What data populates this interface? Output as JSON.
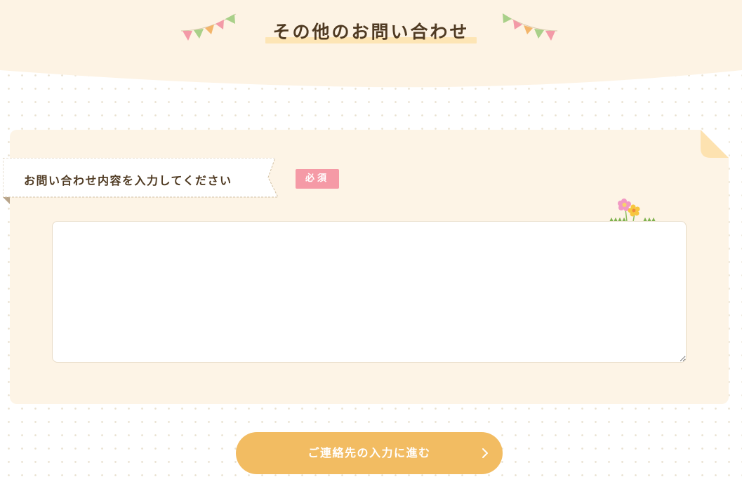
{
  "header": {
    "title": "その他のお問い合わせ"
  },
  "form": {
    "field_label": "お問い合わせ内容を入力してください",
    "required_badge": "必須",
    "textarea_value": "",
    "submit_label": "ご連絡先の入力に進む",
    "submit_icon": "chevron-right-icon"
  },
  "decor": {
    "garland_left_icon": "bunting-icon",
    "garland_right_icon": "bunting-icon",
    "flowers_icon": "flowers-icon",
    "corner_icon": "page-curl-icon"
  },
  "colors": {
    "header_bg": "#fdf3e4",
    "card_bg": "#fdf4e6",
    "accent_orange": "#f2bc62",
    "required_pink": "#f59aa6",
    "title_highlight": "#fde5b5",
    "text_brown": "#4f3a22"
  }
}
